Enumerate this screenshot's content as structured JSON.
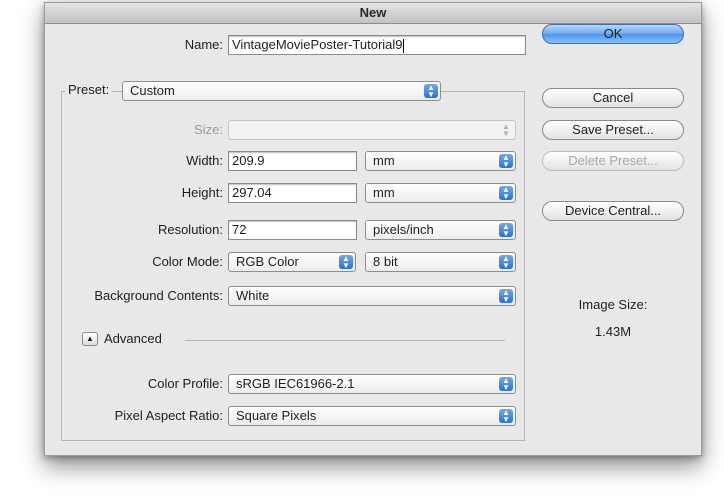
{
  "dialog": {
    "title": "New",
    "name_label": "Name:",
    "name_value": "VintageMoviePoster-Tutorial9",
    "preset_label": "Preset:",
    "preset_value": "Custom",
    "size_label": "Size:",
    "size_value": "",
    "width_label": "Width:",
    "width_value": "209.9",
    "width_unit": "mm",
    "height_label": "Height:",
    "height_value": "297.04",
    "height_unit": "mm",
    "resolution_label": "Resolution:",
    "resolution_value": "72",
    "resolution_unit": "pixels/inch",
    "color_mode_label": "Color Mode:",
    "color_mode_value": "RGB Color",
    "bit_depth_value": "8 bit",
    "background_label": "Background Contents:",
    "background_value": "White",
    "advanced_label": "Advanced",
    "color_profile_label": "Color Profile:",
    "color_profile_value": "sRGB IEC61966-2.1",
    "pixel_aspect_label": "Pixel Aspect Ratio:",
    "pixel_aspect_value": "Square Pixels",
    "image_size_label": "Image Size:",
    "image_size_value": "1.43M"
  },
  "buttons": {
    "ok": "OK",
    "cancel": "Cancel",
    "save_preset": "Save Preset...",
    "delete_preset": "Delete Preset...",
    "device_central": "Device Central..."
  },
  "colors": {
    "dialog_bg": "#e8e8e8",
    "ok_button": "#6aa8f2",
    "popup_arrows": "#2f6fcf"
  },
  "icons": {
    "popup_arrows": "up-down-arrows-icon",
    "disclosure": "triangle-up-icon"
  }
}
